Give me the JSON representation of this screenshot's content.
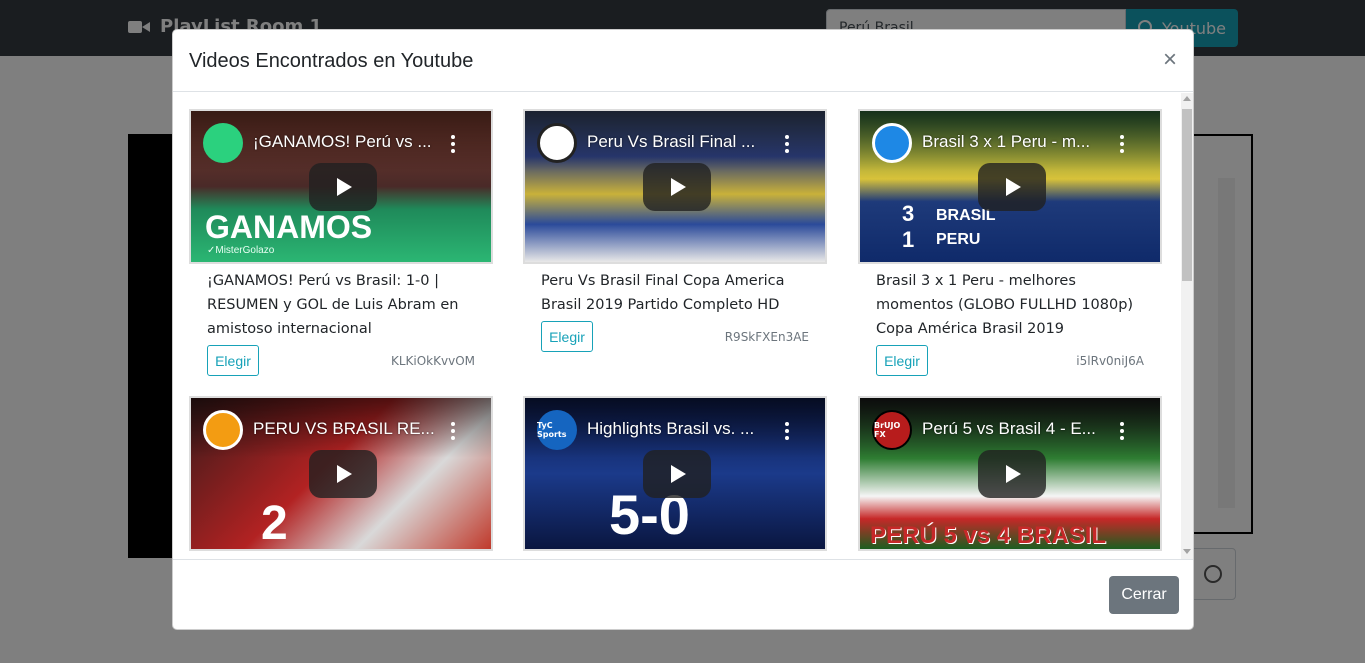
{
  "page": {
    "brand": "PlayList Room 1",
    "search_value": "Perú Brasil",
    "search_button": "Youtube"
  },
  "modal": {
    "title": "Videos Encontrados en Youtube",
    "close_symbol": "×",
    "footer_button": "Cerrar",
    "choose_label": "Elegir",
    "videos": [
      {
        "thumb_title": "¡GANAMOS! Perú vs ...",
        "title": "¡GANAMOS! Perú vs Brasil: 1-0 | RESUMEN y GOL de Luis Abram en amistoso internacional",
        "id": "KLKiOkKvvOM",
        "overlay": "GANAMOS",
        "overlay_sub": "✓MisterGolazo"
      },
      {
        "thumb_title": "Peru Vs Brasil Final ...",
        "title": "Peru Vs Brasil Final Copa America Brasil 2019 Partido Completo HD",
        "id": "R9SkFXEn3AE"
      },
      {
        "thumb_title": "Brasil 3 x 1 Peru - m...",
        "title": "Brasil 3 x 1 Peru - melhores momentos (GLOBO FULLHD 1080p) Copa América Brasil 2019",
        "id": "i5lRv0niJ6A",
        "overlay": "BRASIL",
        "overlay_2": "PERU",
        "score_1": "3",
        "score_2": "1"
      },
      {
        "thumb_title": "PERU VS BRASIL RE...",
        "overlay": "2"
      },
      {
        "thumb_title": "Highlights Brasil vs. ...",
        "overlay": "5-0",
        "channel": "TyC Sports"
      },
      {
        "thumb_title": "Perú 5 vs Brasil 4 - E...",
        "overlay": "PERÚ 5 vs 4 BRASIL",
        "channel": "BrUJO FX"
      }
    ]
  },
  "colors": {
    "accent": "#17a2b8",
    "secondary": "#6c757d",
    "topbar": "#343a40"
  }
}
